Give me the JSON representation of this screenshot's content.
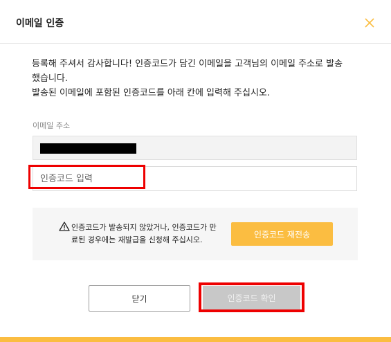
{
  "dialog": {
    "title": "이메일 인증",
    "close_icon": "close-icon",
    "message_line1": "등록해 주셔서 감사합니다! 인증코드가 담긴 이메일을 고객님의 이메일 주소로 발송",
    "message_line2": "했습니다.",
    "message_line3": "발송된 이메일에 포함된 인증코드를 아래 칸에 입력해 주십시오."
  },
  "email_section": {
    "label": "이메일 주소",
    "value_redacted": true
  },
  "code_input": {
    "placeholder": "인증코드 입력",
    "value": ""
  },
  "notice": {
    "icon": "warning-icon",
    "text_line1": "인증코드가 발송되지 않았거나, 인증코드가 만",
    "text_line2": "료된 경우에는 재발급을 신청해 주십시오.",
    "resend_label": "인증코드 재전송"
  },
  "footer": {
    "close_label": "닫기",
    "confirm_label": "인증코드 확인"
  },
  "colors": {
    "accent": "#fbbd41",
    "highlight": "#ee0000",
    "disabled_button": "#c8c8c8"
  }
}
